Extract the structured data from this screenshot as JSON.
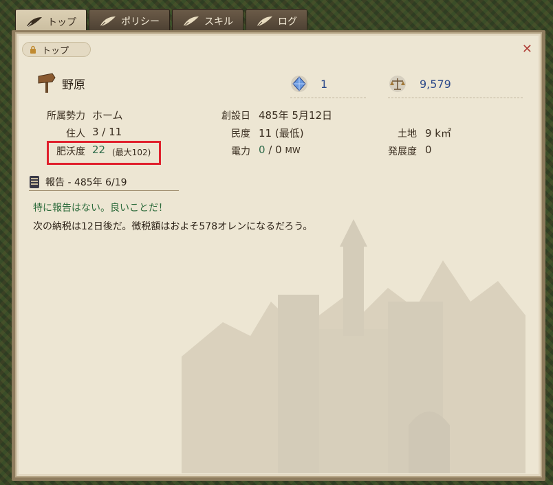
{
  "tabs": [
    {
      "label": "トップ",
      "icon": "quill-icon",
      "active": true
    },
    {
      "label": "ポリシー",
      "icon": "quill-icon",
      "active": false
    },
    {
      "label": "スキル",
      "icon": "quill-icon",
      "active": false
    },
    {
      "label": "ログ",
      "icon": "quill-icon",
      "active": false
    }
  ],
  "breadcrumb": {
    "label": "トップ"
  },
  "header": {
    "name": "野原",
    "crystal_value": "1",
    "money_value": "9,579"
  },
  "info": {
    "faction_label": "所属勢力",
    "faction_value": "ホーム",
    "residents_label": "住人",
    "residents_value": "3 / 11",
    "fertility_label": "肥沃度",
    "fertility_value": "22",
    "fertility_max": "(最大102)",
    "founded_label": "創設日",
    "founded_value": "485年 5月12日",
    "morale_label": "民度",
    "morale_value": "11 (最低)",
    "power_label": "電力",
    "power_current": "0",
    "power_rest": "/ 0",
    "power_unit": "MW",
    "land_label": "土地",
    "land_value": "9 k㎡",
    "development_label": "発展度",
    "development_value": "0"
  },
  "report": {
    "title": "報告 - 485年 6/19",
    "line1": "特に報告はない。良いことだ！",
    "line2": "次の納税は12日後だ。徴税額はおよそ578オレンになるだろう。"
  },
  "colors": {
    "highlight": "#e0202c",
    "accent_blue": "#2d4a8a",
    "good_green": "#2b6a3a",
    "close_red": "#b04038"
  }
}
